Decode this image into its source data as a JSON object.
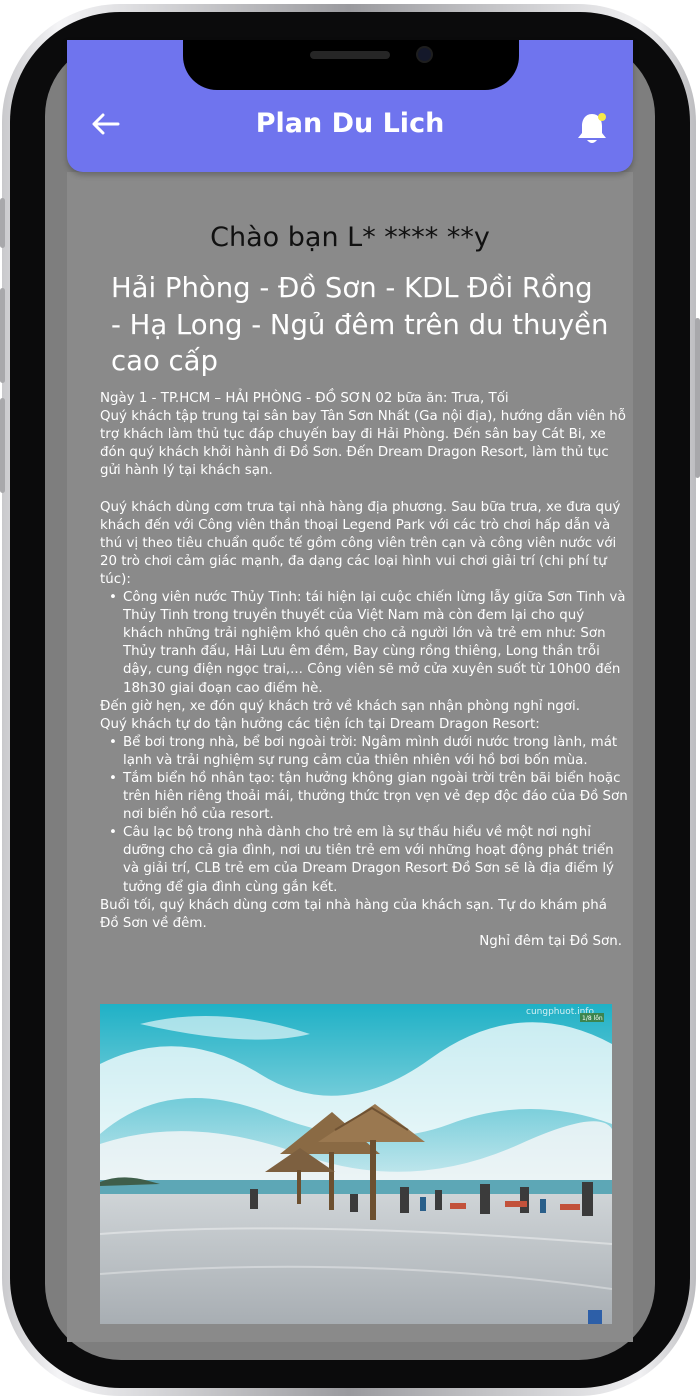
{
  "app": {
    "title": "Plan Du Lich",
    "accent_color": "#6f74ee",
    "back_icon": "arrow-left-icon",
    "notification_icon": "bell-icon"
  },
  "greeting": "Chào bạn L* **** **y",
  "tour": {
    "title": "Hải Phòng - Đồ Sơn - KDL Đồi Rồng - Hạ Long - Ngủ đêm trên du thuyền cao cấp",
    "day_header": "Ngày 1 - TP.HCM – HẢI PHÒNG - ĐỒ SƠN 02 bữa ăn: Trưa, Tối",
    "p1": "Quý khách tập trung tại sân bay Tân Sơn Nhất (Ga nội địa), hướng dẫn viên hỗ trợ khách làm thủ tục đáp chuyến bay đi Hải Phòng. Đến sân bay Cát Bi, xe đón quý khách khởi hành đi Đồ Sơn. Đến Dream Dragon Resort, làm thủ tục gửi hành lý tại khách sạn.",
    "p2": "Quý khách dùng cơm trưa tại nhà hàng địa phương. Sau bữa trưa, xe đưa quý khách đến với Công viên thần thoại Legend Park với các trò chơi hấp dẫn và thú vị theo tiêu chuẩn quốc tế gồm công viên trên cạn và công viên nước với 20 trò chơi cảm giác mạnh, đa dạng các loại hình vui chơi giải trí (chi phí tự túc):",
    "list1": [
      "Công viên nước Thủy Tinh: tái hiện lại cuộc chiến lừng lẫy giữa Sơn Tinh và Thủy Tinh trong truyền thuyết của Việt Nam mà còn đem lại cho quý khách những trải nghiệm khó quên cho cả người lớn và trẻ em như: Sơn Thủy tranh đấu, Hải Lưu êm đềm, Bay cùng rồng thiêng, Long thần trỗi dậy, cung điện ngọc trai,... Công viên sẽ mở cửa xuyên suốt từ 10h00 đến 18h30 giai đoạn cao điểm hè."
    ],
    "p3": "Đến giờ hẹn, xe đón quý khách trở về khách sạn nhận phòng nghỉ ngơi.",
    "p4": "Quý khách tự do tận hưởng các tiện ích tại Dream Dragon Resort:",
    "list2": [
      "Bể bơi trong nhà, bể bơi ngoài trời: Ngâm mình dưới nước trong lành, mát lạnh và trải nghiệm sự rung cảm của thiên nhiên với hồ bơi bốn mùa.",
      "Tắm biển hồ nhân tạo: tận hưởng không gian ngoài trời trên bãi biển hoặc trên hiên riêng thoải mái, thưởng thức trọn vẹn vẻ đẹp độc đáo của Đồ Sơn nơi biển hồ của resort.",
      "Câu lạc bộ trong nhà dành cho trẻ em là sự thấu hiểu về một nơi nghỉ dưỡng cho cả gia đình, nơi ưu tiên trẻ em với những hoạt động phát triển và giải trí, CLB trẻ em của Dream Dragon Resort Đồ Sơn sẽ là địa điểm lý tưởng để gia đình cùng gắn kết."
    ],
    "p5": "Buổi tối, quý khách dùng cơm tại nhà hàng của khách sạn. Tự do khám phá Đồ Sơn về đêm.",
    "overnight": "Nghỉ đêm tại Đồ Sơn.",
    "photo": {
      "watermark": "cungphuot.info",
      "badge": "1/8 lồn"
    }
  }
}
